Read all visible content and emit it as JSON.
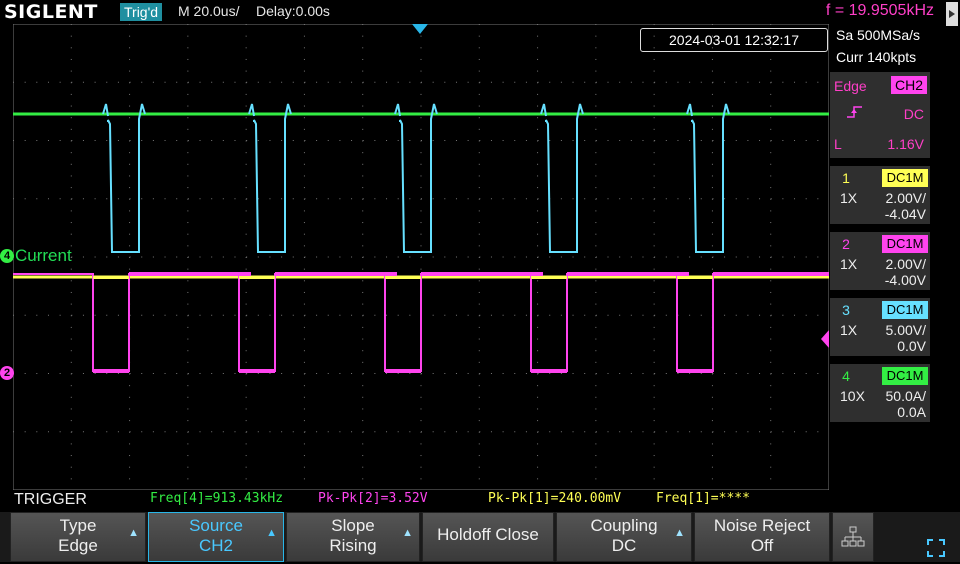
{
  "header": {
    "brand": "SIGLENT",
    "trig_status": "Trig'd",
    "timebase": "M 20.0us/",
    "delay": "Delay:0.00s",
    "frequency": "f = 19.9505kHz"
  },
  "datetime": "2024-03-01 12:32:17",
  "acquisition": {
    "sample_rate": "Sa 500MSa/s",
    "memory": "Curr 140kpts"
  },
  "trigger_panel": {
    "type": "Edge",
    "source": "CH2",
    "coupling": "DC",
    "level_prefix": "L",
    "level": "1.16V"
  },
  "channels": [
    {
      "num": "1",
      "coupling": "DC1M",
      "probe": "1X",
      "vdiv": "2.00V/",
      "offset": "-4.04V",
      "color": "#ffff55"
    },
    {
      "num": "2",
      "coupling": "DC1M",
      "probe": "1X",
      "vdiv": "2.00V/",
      "offset": "-4.00V",
      "color": "#ff44ee"
    },
    {
      "num": "3",
      "coupling": "DC1M",
      "probe": "1X",
      "vdiv": "5.00V/",
      "offset": "0.0V",
      "color": "#66e0ff"
    },
    {
      "num": "4",
      "coupling": "DC1M",
      "probe": "10X",
      "vdiv": "50.0A/",
      "offset": "0.0A",
      "color": "#33ee44"
    }
  ],
  "waveform_labels": {
    "ch4_marker": "4",
    "ch4_name": "Current",
    "ch2_marker": "2"
  },
  "measurements": {
    "title": "TRIGGER",
    "items": [
      {
        "text": "Freq[4]=913.43kHz",
        "color": "#33ee44"
      },
      {
        "text": "Pk-Pk[2]=3.52V",
        "color": "#ff44ee"
      },
      {
        "text": "Pk-Pk[1]=240.00mV",
        "color": "#ffff55"
      },
      {
        "text": "Freq[1]=****",
        "color": "#ffff55"
      }
    ]
  },
  "softkeys": [
    {
      "l1": "Type",
      "l2": "Edge"
    },
    {
      "l1": "Source",
      "l2": "CH2"
    },
    {
      "l1": "Slope",
      "l2": "Rising"
    },
    {
      "l1": "Holdoff Close",
      "l2": ""
    },
    {
      "l1": "Coupling",
      "l2": "DC"
    },
    {
      "l1": "Noise Reject",
      "l2": "Off"
    }
  ],
  "icons": {
    "network": "network-icon",
    "fullscreen": "fullscreen-icon",
    "trigger_slope": "rising-edge-icon"
  }
}
